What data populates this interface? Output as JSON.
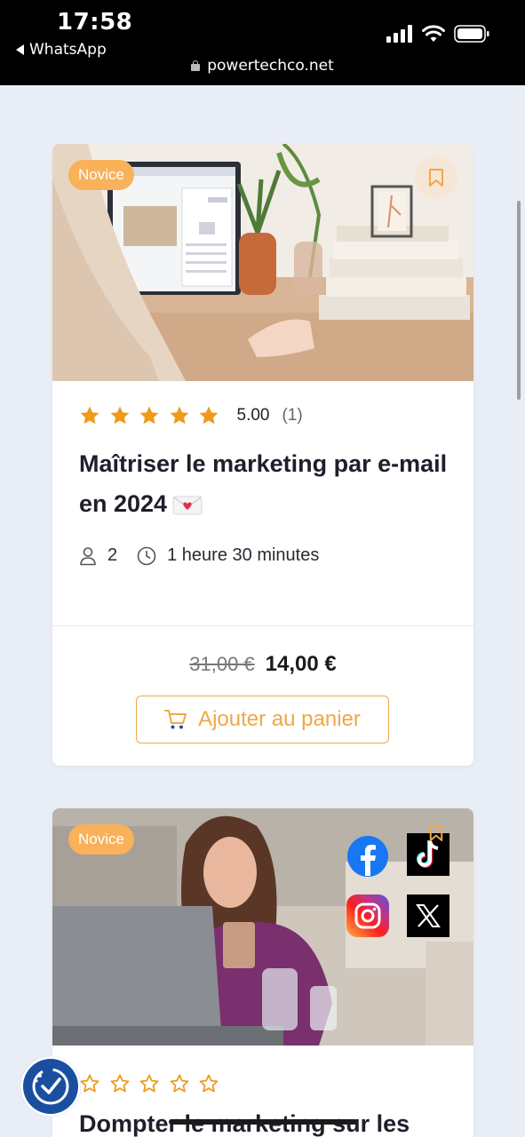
{
  "status_bar": {
    "time": "17:58",
    "back_app": "WhatsApp",
    "url": "powertechco.net"
  },
  "colors": {
    "accent": "#f0a748",
    "badge": "#f9b15a",
    "star": "#ef9a1b",
    "background": "#e9edf5"
  },
  "courses": [
    {
      "level": "Novice",
      "rating": {
        "stars": 5,
        "value": "5.00",
        "count": "(1)"
      },
      "title": "Maîtriser le marketing par e-mail en 2024",
      "title_icon": "love-letter-icon",
      "students": "2",
      "duration": "1 heure 30 minutes",
      "old_price": "31,00 €",
      "price": "14,00 €",
      "cart_label": "Ajouter au panier"
    },
    {
      "level": "Novice",
      "rating": {
        "stars": 0
      },
      "title": "Dompter le marketing sur les"
    }
  ]
}
